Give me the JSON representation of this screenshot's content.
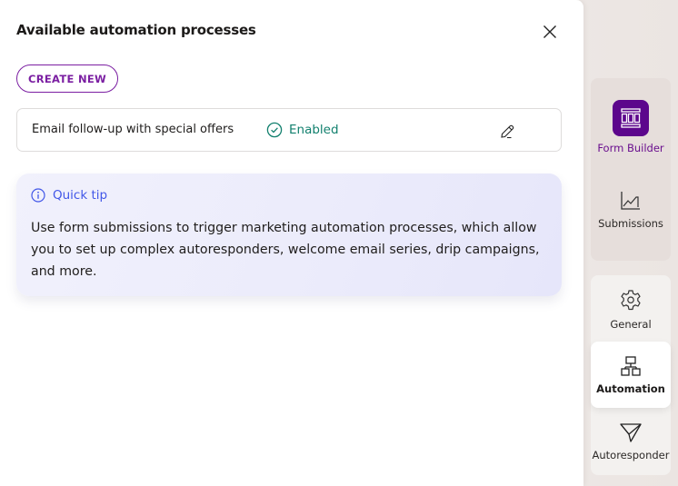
{
  "panel": {
    "title": "Available automation processes",
    "close_icon": "close-icon",
    "create_button_label": "CREATE NEW",
    "processes": [
      {
        "name": "Email follow-up with special offers",
        "status": "Enabled",
        "status_icon": "check-circle-icon",
        "edit_icon": "pencil-icon"
      }
    ],
    "tip": {
      "icon": "info-icon",
      "title": "Quick tip",
      "body": "Use form submissions to trigger marketing automation processes, which allow you to set up complex autoresponders, welcome email series, drip campaigns, and more."
    }
  },
  "sidebar": {
    "items": [
      {
        "label": "Form Builder",
        "icon": "form-builder-icon",
        "state": "primary"
      },
      {
        "label": "Submissions",
        "icon": "chart-icon",
        "state": "default"
      },
      {
        "label": "General",
        "icon": "gear-icon",
        "state": "default"
      },
      {
        "label": "Automation",
        "icon": "sitemap-icon",
        "state": "selected"
      },
      {
        "label": "Autoresponder",
        "icon": "paper-plane-icon",
        "state": "default"
      }
    ]
  },
  "colors": {
    "brand": "#7b1fa2",
    "brand_dark": "#5c068c",
    "enabled": "#12806e",
    "tip_accent": "#4257e8"
  }
}
